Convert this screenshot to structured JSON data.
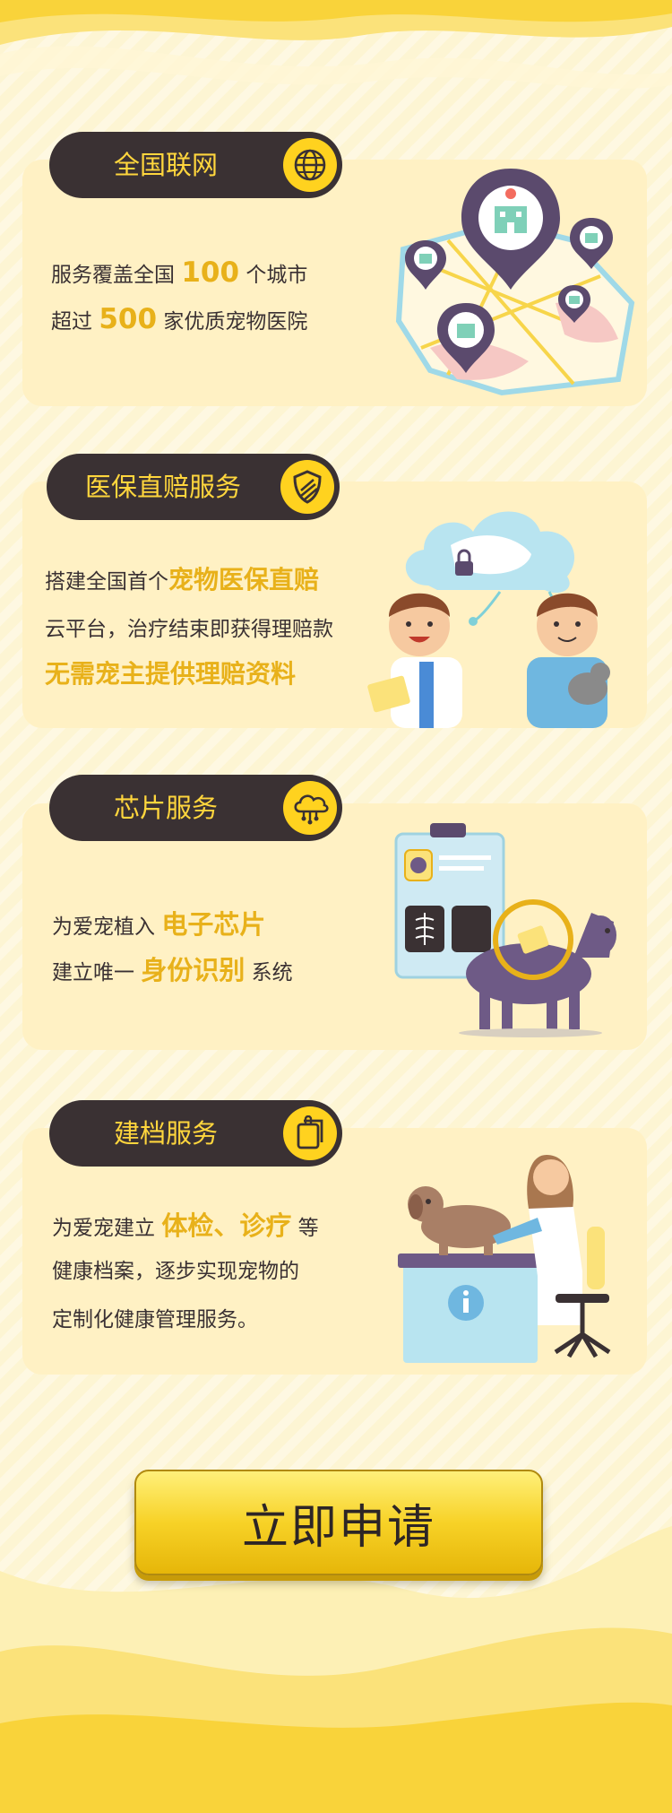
{
  "sections": {
    "network": {
      "title": "全国联网",
      "icon": "globe-icon",
      "line1_prefix": "服务覆盖全国",
      "line1_number": "100",
      "line1_suffix": "个城市",
      "line2_prefix": "超过",
      "line2_number": "500",
      "line2_suffix": "家优质宠物医院"
    },
    "insurance": {
      "title": "医保直赔服务",
      "icon": "shield-icon",
      "line1_prefix": "搭建全国首个",
      "line1_highlight": "宠物医保直赔",
      "line2": "云平台，治疗结束即获得理赔款",
      "line3_highlight": "无需宠主提供理赔资料"
    },
    "chip": {
      "title": "芯片服务",
      "icon": "cloud-network-icon",
      "line1_prefix": "为爱宠植入",
      "line1_highlight": "电子芯片",
      "line2_prefix": "建立唯一",
      "line2_highlight": "身份识别",
      "line2_suffix": "系统"
    },
    "records": {
      "title": "建档服务",
      "icon": "clipboard-icon",
      "line1_prefix": "为爱宠建立",
      "line1_highlight": "体检、诊疗",
      "line1_suffix": "等",
      "line2": "健康档案，逐步实现宠物的",
      "line3": "定制化健康管理服务。"
    }
  },
  "cta": {
    "label": "立即申请"
  },
  "colors": {
    "background": "#fdf5d3",
    "card": "#fff1c4",
    "pill": "#3a3133",
    "accent": "#ffd21f",
    "highlight_text": "#e8b11a",
    "body_text": "#3a3133"
  }
}
